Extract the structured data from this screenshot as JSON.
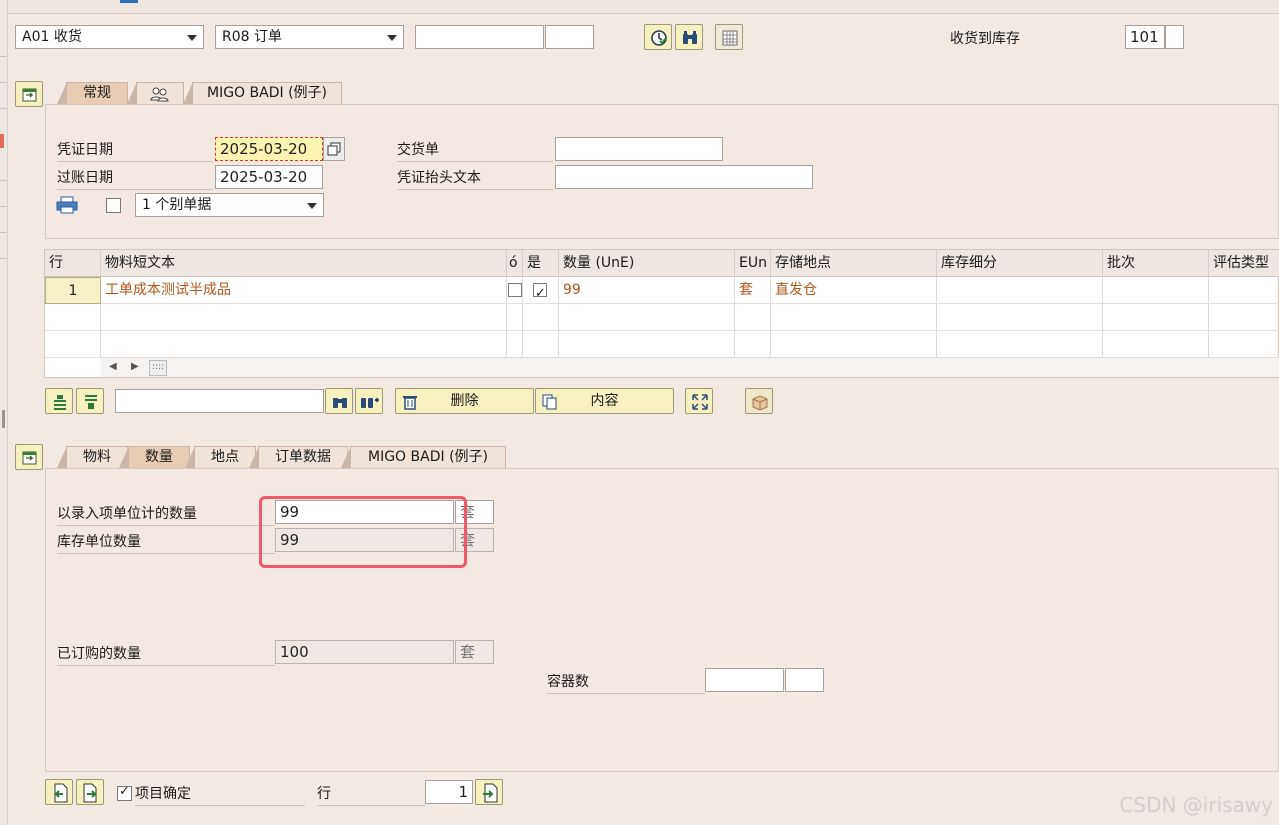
{
  "header": {
    "action_select": "A01 收货",
    "ref_select": "R08 订单",
    "ref_number": "",
    "ref_item": "",
    "receipt_label": "收货到库存",
    "movement_type": "101",
    "movement_ext": ""
  },
  "header_tabs": [
    "常规",
    "",
    "MIGO BADI (例子)"
  ],
  "general": {
    "doc_date_label": "凭证日期",
    "doc_date": "2025-03-20",
    "post_date_label": "过账日期",
    "post_date": "2025-03-20",
    "delivery_label": "交货单",
    "delivery_value": "",
    "header_text_label": "凭证抬头文本",
    "header_text_value": "",
    "print_select": "1 个别单据"
  },
  "item_table": {
    "columns": [
      "行",
      "物料短文本",
      "ó",
      "是",
      "数量 (UnE)",
      "EUn",
      "存储地点",
      "库存细分",
      "批次",
      "评估类型"
    ],
    "rows": [
      {
        "line": "1",
        "text": "工单成本测试半成品",
        "ok": false,
        "yes": true,
        "qty": "99",
        "unit": "套",
        "sloc": "直发仓",
        "stock": "",
        "batch": "",
        "val": ""
      }
    ]
  },
  "toolbar2": {
    "search_value": "",
    "delete_label": "删除",
    "content_label": "内容"
  },
  "detail_tabs": [
    "物料",
    "数量",
    "地点",
    "订单数据",
    "MIGO BADI (例子)"
  ],
  "quantity": {
    "entry_qty_label": "以录入项单位计的数量",
    "entry_qty": "99",
    "entry_unit": "套",
    "stock_qty_label": "库存单位数量",
    "stock_qty": "99",
    "stock_unit": "套",
    "ordered_label": "已订购的数量",
    "ordered_qty": "100",
    "ordered_unit": "套",
    "container_label": "容器数",
    "container_value": "",
    "container_ext": ""
  },
  "footer": {
    "item_ok_label": "项目确定",
    "item_ok_checked": true,
    "line_label": "行",
    "line_value": "1"
  },
  "watermark": "CSDN @irisawy"
}
